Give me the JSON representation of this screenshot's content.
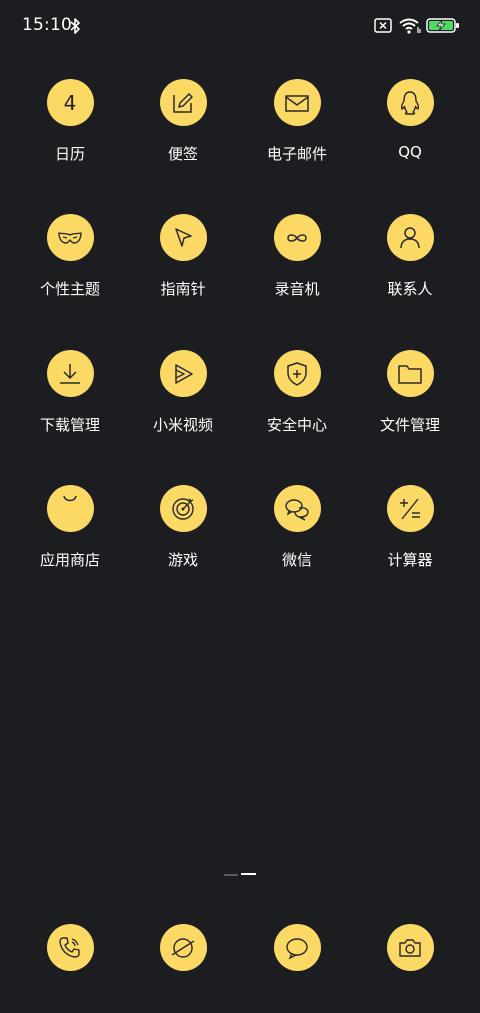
{
  "status_bar": {
    "time": "15:10",
    "icons": [
      "bluetooth-icon",
      "no-sim-icon",
      "wifi-icon",
      "battery-charging-icon"
    ]
  },
  "colors": {
    "background": "#1c1d20",
    "icon_circle": "#fcd964",
    "icon_stroke": "#2a2a2a",
    "label": "#ffffff"
  },
  "calendar_day": "4",
  "apps": [
    {
      "label": "日历",
      "icon": "calendar-icon"
    },
    {
      "label": "便签",
      "icon": "notes-icon"
    },
    {
      "label": "电子邮件",
      "icon": "mail-icon"
    },
    {
      "label": "QQ",
      "icon": "qq-penguin-icon"
    },
    {
      "label": "个性主题",
      "icon": "mask-icon"
    },
    {
      "label": "指南针",
      "icon": "compass-pointer-icon"
    },
    {
      "label": "录音机",
      "icon": "infinity-icon"
    },
    {
      "label": "联系人",
      "icon": "person-icon"
    },
    {
      "label": "下载管理",
      "icon": "download-icon"
    },
    {
      "label": "小米视频",
      "icon": "video-play-icon"
    },
    {
      "label": "安全中心",
      "icon": "shield-plus-icon"
    },
    {
      "label": "文件管理",
      "icon": "folder-icon"
    },
    {
      "label": "应用商店",
      "icon": "shopping-bag-icon"
    },
    {
      "label": "游戏",
      "icon": "target-icon"
    },
    {
      "label": "微信",
      "icon": "chat-bubbles-icon"
    },
    {
      "label": "计算器",
      "icon": "calculator-icon"
    }
  ],
  "dock": [
    {
      "icon": "phone-icon"
    },
    {
      "icon": "browser-icon"
    },
    {
      "icon": "message-icon"
    },
    {
      "icon": "camera-icon"
    }
  ],
  "page_indicator": {
    "pages": 2,
    "current": 2
  }
}
